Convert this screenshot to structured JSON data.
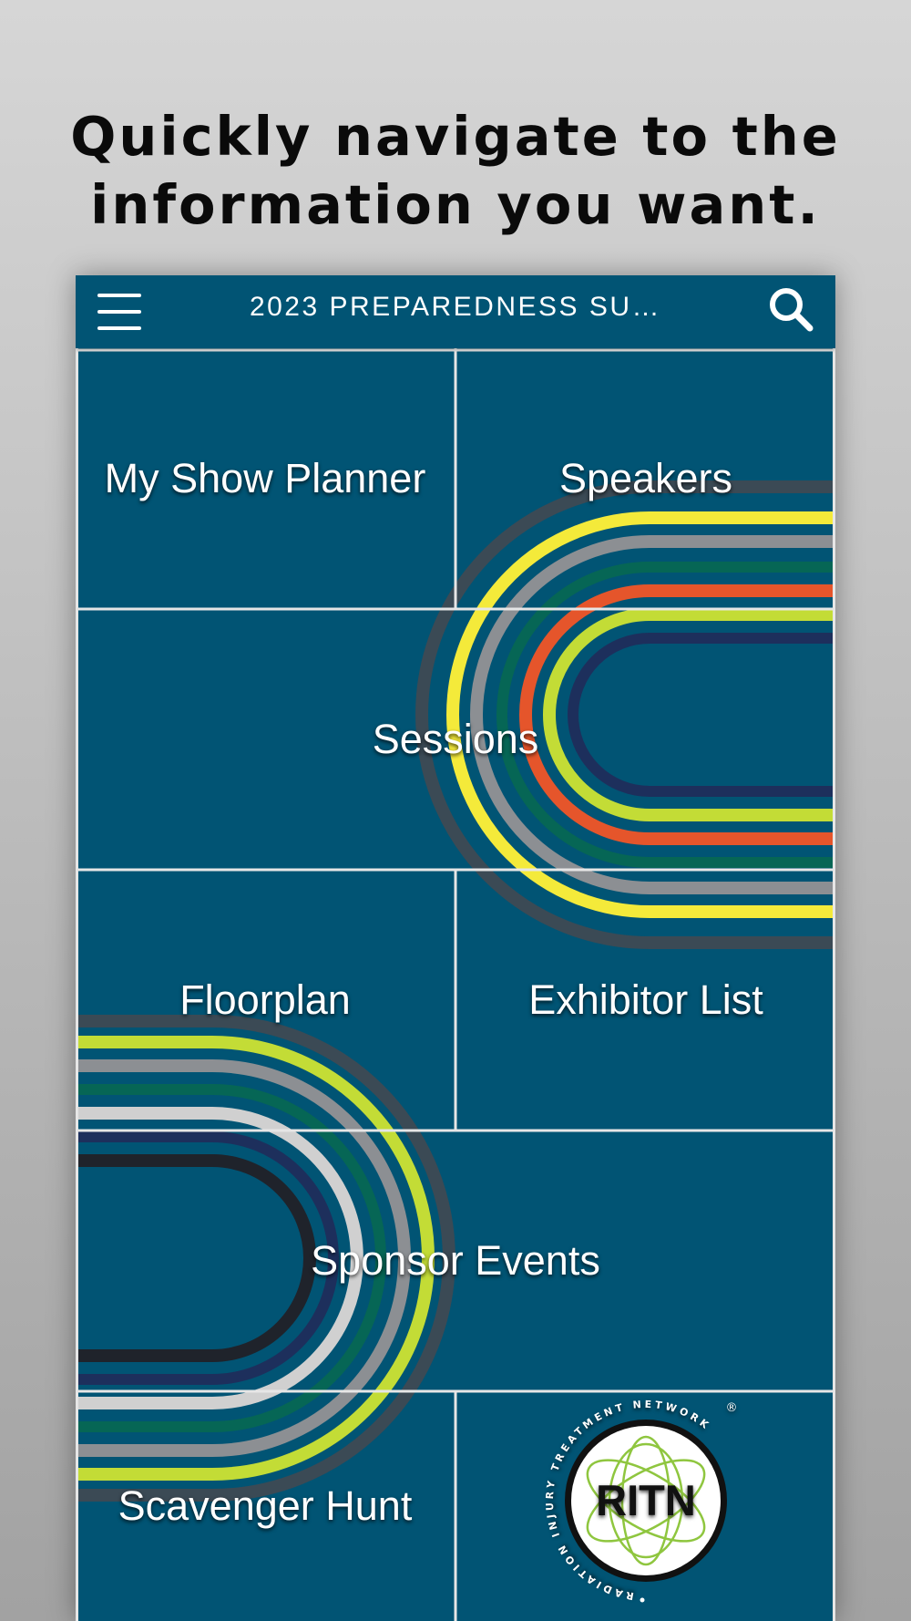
{
  "promo": {
    "headline_line1": "Quickly navigate to the",
    "headline_line2": "information you want."
  },
  "app_bar": {
    "title": "2023 PREPAREDNESS SU…",
    "menu_icon": "hamburger-menu-icon",
    "search_icon": "search-icon"
  },
  "tiles": {
    "my_show_planner": "My Show Planner",
    "speakers": "Speakers",
    "sessions": "Sessions",
    "floorplan": "Floorplan",
    "exhibitor_list": "Exhibitor List",
    "sponsor_events": "Sponsor Events",
    "scavenger_hunt": "Scavenger Hunt"
  },
  "logo": {
    "wordmark": "RITN",
    "ring_text": "RADIATION INJURY TREATMENT NETWORK",
    "registered_mark": "®"
  },
  "colors": {
    "tile_background": "#015474",
    "divider": "#e6e6e6",
    "arc_dark": "#3b4a55",
    "arc_yellow": "#f4ea3a",
    "arc_gray": "#8c8f93",
    "arc_orange": "#e5552b",
    "arc_lime": "#c3dc36",
    "arc_navy": "#1d2f5c"
  }
}
